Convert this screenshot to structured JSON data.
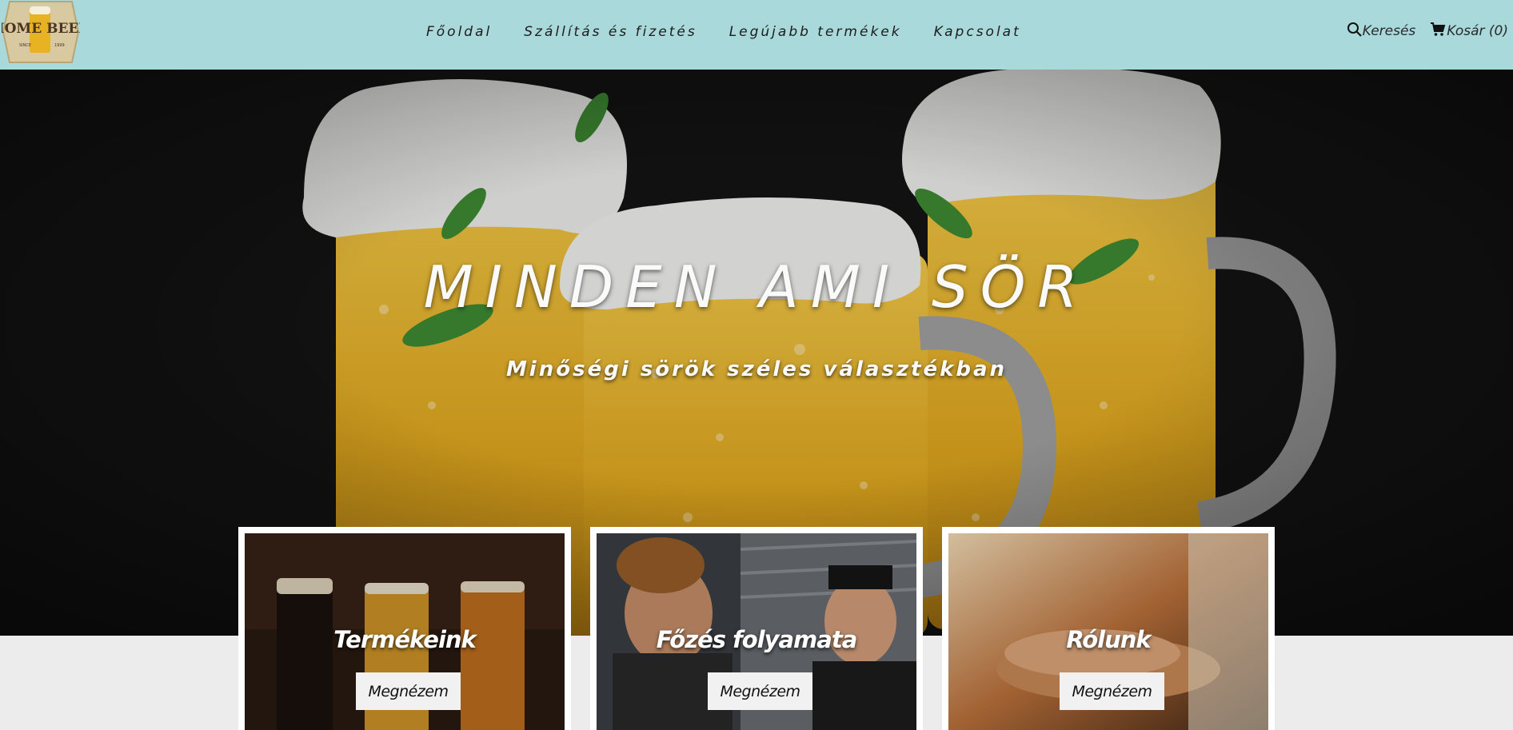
{
  "logo": {
    "line1": "HOME BEER",
    "left_small": "SINCE",
    "right_small": "1999"
  },
  "nav": [
    {
      "label": "Főoldal"
    },
    {
      "label": "Szállítás és fizetés"
    },
    {
      "label": "Legújabb termékek"
    },
    {
      "label": "Kapcsolat"
    }
  ],
  "utility": {
    "search_label": "Keresés",
    "cart_label": "Kosár (0)"
  },
  "hero": {
    "title": "MINDEN AMI SÖR",
    "subtitle": "Minőségi sörök széles választékban"
  },
  "cards": [
    {
      "title": "Termékeink",
      "button": "Megnézem"
    },
    {
      "title": "Főzés folyamata",
      "button": "Megnézem"
    },
    {
      "title": "Rólunk",
      "button": "Megnézem"
    }
  ],
  "colors": {
    "header_bg": "#a9d9da",
    "page_bg": "#ececec",
    "beer": "#e3b22b"
  }
}
